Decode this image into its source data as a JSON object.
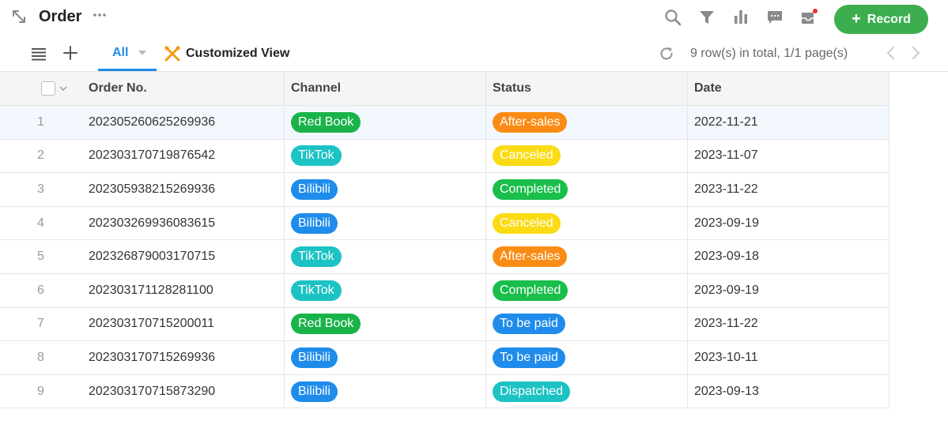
{
  "header": {
    "title": "Order",
    "record_label": "Record",
    "colors": {
      "accent": "#3dae4f",
      "tab_active": "#1f8ceb",
      "notification_dot": "#ee3030"
    }
  },
  "tabs": {
    "active_label": "All",
    "customized_label": "Customized View"
  },
  "pagination": {
    "summary": "9 row(s) in total, 1/1 page(s)"
  },
  "table": {
    "columns": [
      "Order No.",
      "Channel",
      "Status",
      "Date"
    ],
    "rows": [
      {
        "index": "1",
        "order_no": "202305260625269936",
        "channel": "Red Book",
        "status": "After-sales",
        "date": "2022-11-21"
      },
      {
        "index": "2",
        "order_no": "202303170719876542",
        "channel": "TikTok",
        "status": "Canceled",
        "date": "2023-11-07"
      },
      {
        "index": "3",
        "order_no": "202305938215269936",
        "channel": "Bilibili",
        "status": "Completed",
        "date": "2023-11-22"
      },
      {
        "index": "4",
        "order_no": "202303269936083615",
        "channel": "Bilibili",
        "status": "Canceled",
        "date": "2023-09-19"
      },
      {
        "index": "5",
        "order_no": "202326879003170715",
        "channel": "TikTok",
        "status": "After-sales",
        "date": "2023-09-18"
      },
      {
        "index": "6",
        "order_no": "202303171128281100",
        "channel": "TikTok",
        "status": "Completed",
        "date": "2023-09-19"
      },
      {
        "index": "7",
        "order_no": "202303170715200011",
        "channel": "Red Book",
        "status": "To be paid",
        "date": "2023-11-22"
      },
      {
        "index": "8",
        "order_no": "202303170715269936",
        "channel": "Bilibili",
        "status": "To be paid",
        "date": "2023-10-11"
      },
      {
        "index": "9",
        "order_no": "202303170715873290",
        "channel": "Bilibili",
        "status": "Dispatched",
        "date": "2023-09-13"
      }
    ]
  },
  "tag_colors": {
    "Red Book": "#1ab34a",
    "TikTok": "#1cc2c4",
    "Bilibili": "#1f8ceb",
    "After-sales": "#fa8c16",
    "Canceled": "#fadb14",
    "Completed": "#19be4b",
    "To be paid": "#1f8ceb",
    "Dispatched": "#1cc2c4"
  },
  "icons": [
    "expand-icon",
    "more-icon",
    "search-icon",
    "filter-icon",
    "chart-icon",
    "comment-icon",
    "inbox-icon",
    "menu-icon",
    "add-icon",
    "wrench-icon",
    "refresh-icon",
    "chevron-left-icon",
    "chevron-right-icon"
  ]
}
